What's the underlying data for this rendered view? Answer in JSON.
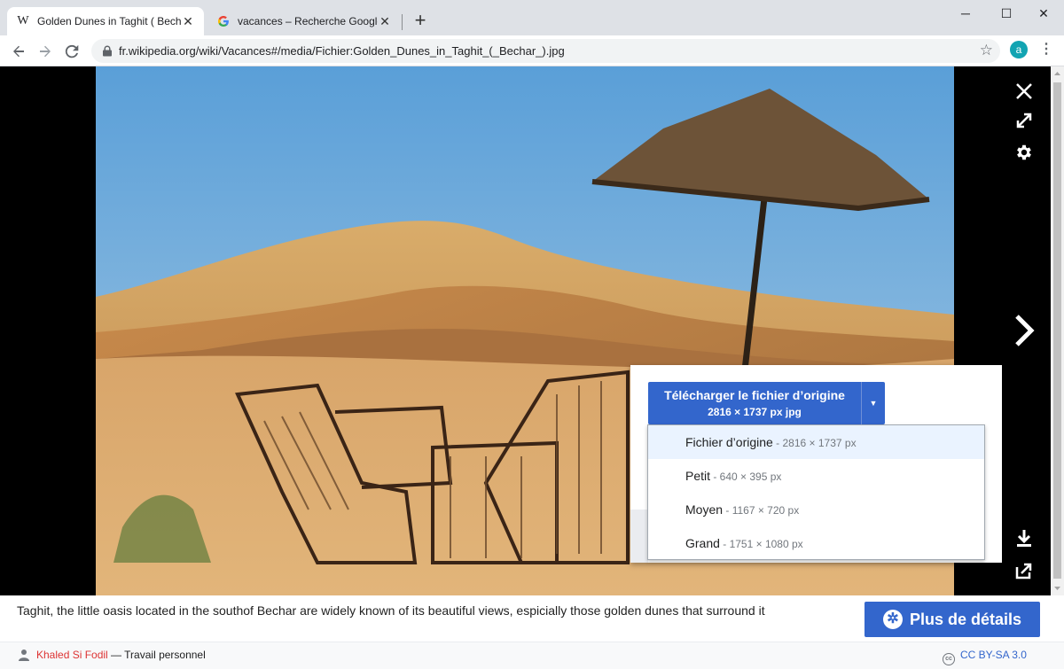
{
  "browser": {
    "tabs": [
      {
        "title": "Golden Dunes in Taghit ( Bechar )",
        "favicon": "W",
        "active": true
      },
      {
        "title": "vacances – Recherche Google",
        "favicon": "G",
        "active": false
      }
    ],
    "new_tab": "+",
    "window": {
      "minimize": "─",
      "maximize": "☐",
      "close": "✕"
    },
    "url": "fr.wikipedia.org/wiki/Vacances#/media/Fichier:Golden_Dunes_in_Taghit_(_Bechar_).jpg",
    "profile_initial": "a",
    "icons": {
      "back": "arrow-left-icon",
      "forward": "arrow-right-icon",
      "reload": "reload-icon",
      "bookmark": "star-icon",
      "menu": "kebab-menu-icon"
    }
  },
  "viewer": {
    "photo_alt": "Golden Dunes in Taghit ( Bechar )",
    "download": {
      "button_label": "Télécharger le fichier d’origine",
      "button_sub": "2816 × 1737 px jpg",
      "options": [
        {
          "label": "Fichier d’origine",
          "size": " - 2816 × 1737 px",
          "selected": true
        },
        {
          "label": "Petit",
          "size": " - 640 × 395 px",
          "selected": false
        },
        {
          "label": "Moyen",
          "size": " - 1167 × 720 px",
          "selected": false
        },
        {
          "label": "Grand",
          "size": " - 1751 × 1080 px",
          "selected": false
        }
      ]
    },
    "caption": "Taghit, the little oasis located in the southof Bechar are widely known of its beautiful views, espicially those golden dunes that surround it",
    "more_details": "Plus de détails",
    "author": "Khaled Si Fodil",
    "author_suffix": " — Travail personnel",
    "license": "CC BY-SA 3.0"
  },
  "colors": {
    "accent": "#3366cc",
    "viewer_bg": "#000000",
    "author_link": "#dd3333"
  }
}
